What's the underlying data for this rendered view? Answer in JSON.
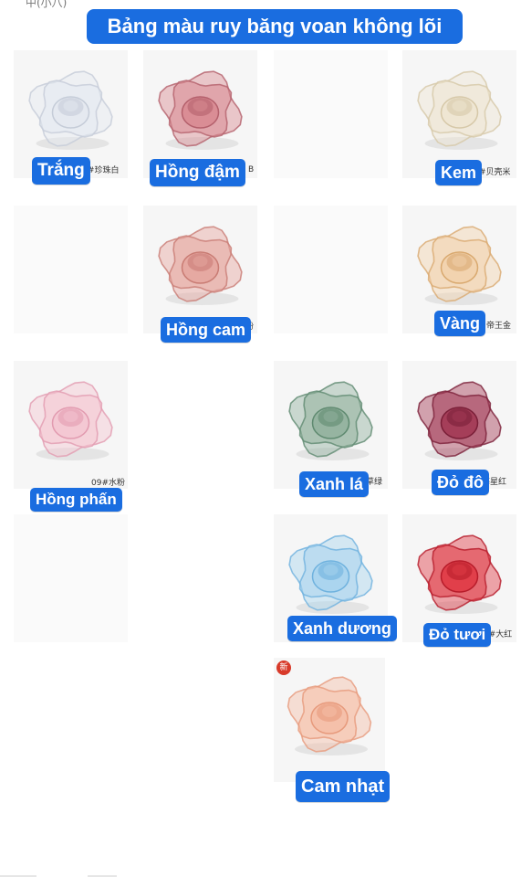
{
  "title": "Bảng màu ruy băng voan không lõi",
  "top_fragment": "中(小八)",
  "products": [
    {
      "name": "Trắng",
      "code": "#珍珠白",
      "color": "#e4e9f0",
      "shade": "#c5ccd8"
    },
    {
      "name": "Hồng đậm",
      "code": "B",
      "color": "#d98b92",
      "shade": "#b4606c"
    },
    {
      "name": "Kem",
      "code": "#贝壳米",
      "color": "#eee5d2",
      "shade": "#d6c8a8"
    },
    {
      "name": "Hồng cam",
      "code": "粉",
      "color": "#e6a7a0",
      "shade": "#c97c74"
    },
    {
      "name": "Vàng",
      "code": "帝王金",
      "color": "#f2d2ad",
      "shade": "#d9a96f"
    },
    {
      "name": "Hồng phấn",
      "code": "09#水粉",
      "color": "#f4c6d1",
      "shade": "#e29bb0"
    },
    {
      "name": "Xanh lá",
      "code": "草绿",
      "color": "#93b29f",
      "shade": "#5f8a70"
    },
    {
      "name": "Đỏ đô",
      "code": "海星红",
      "color": "#a33a55",
      "shade": "#7a1f38"
    },
    {
      "name": "Xanh dương",
      "code": "",
      "color": "#a9d4ee",
      "shade": "#6fb2de"
    },
    {
      "name": "Đỏ tươi",
      "code": "6#大红",
      "color": "#e03b46",
      "shade": "#b71c2a"
    },
    {
      "name": "Cam nhạt",
      "code": "",
      "color": "#f5bfa8",
      "shade": "#e79a7c",
      "badge": "新"
    }
  ]
}
